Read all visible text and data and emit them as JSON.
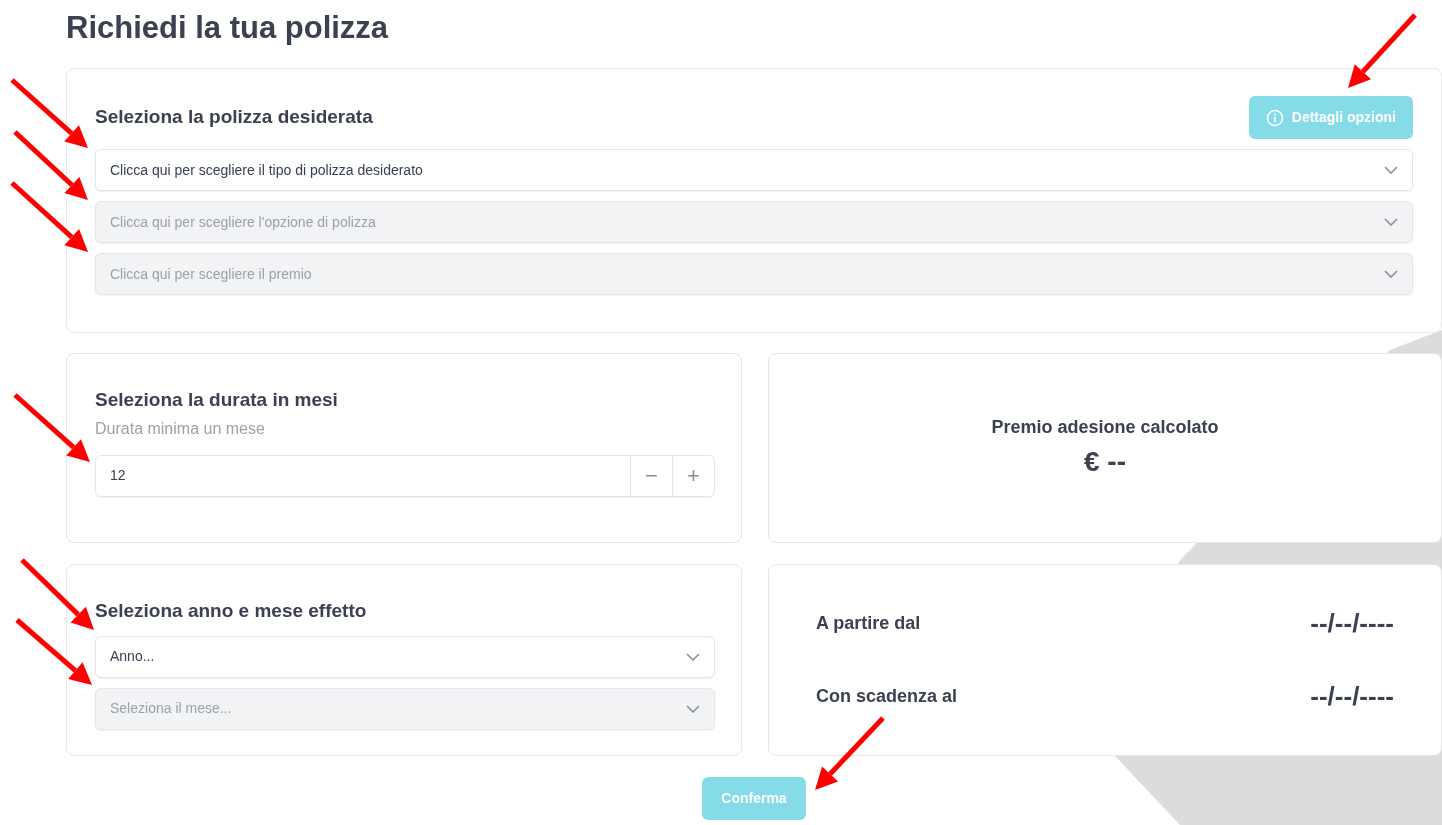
{
  "title": "Richiedi la tua polizza",
  "policy_card": {
    "heading": "Seleziona la polizza desiderata",
    "details_button": {
      "label": "Dettagli opzioni",
      "disabled": true
    },
    "selects": [
      {
        "placeholder": "Clicca qui per scegliere il tipo di polizza desiderato",
        "disabled": false
      },
      {
        "placeholder": "Clicca qui per scegliere l'opzione di polizza",
        "disabled": true
      },
      {
        "placeholder": "Clicca qui per scegliere il premio",
        "disabled": true
      }
    ]
  },
  "duration_card": {
    "heading": "Seleziona la durata in mesi",
    "hint": "Durata minima un mese",
    "value": "12",
    "decrement": "−",
    "increment": "+"
  },
  "premium_card": {
    "label": "Premio adesione calcolato",
    "amount": "€ --"
  },
  "effect_card": {
    "heading": "Seleziona anno e mese effetto",
    "selects": [
      {
        "placeholder": "Anno...",
        "disabled": false
      },
      {
        "placeholder": "Seleziona il mese...",
        "disabled": true
      }
    ]
  },
  "dates_card": {
    "rows": [
      {
        "label": "A partire dal",
        "value": "--/--/----"
      },
      {
        "label": "Con scadenza al",
        "value": "--/--/----"
      }
    ]
  },
  "confirm_button": {
    "label": "Conferma",
    "disabled": true
  }
}
